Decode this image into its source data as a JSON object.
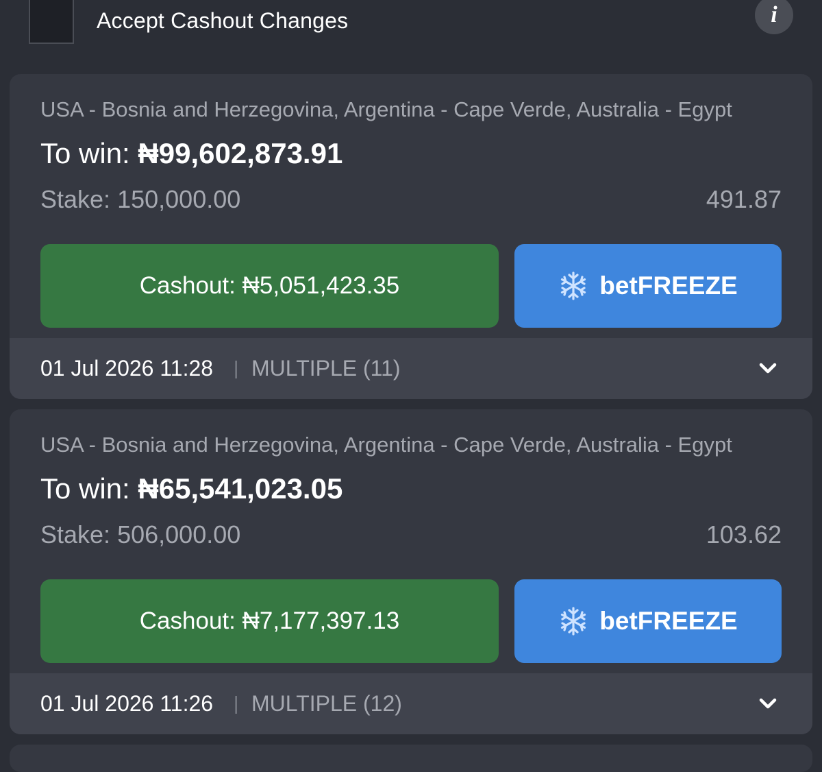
{
  "header": {
    "accept_label": "Accept Cashout Changes",
    "info_icon": "info-icon"
  },
  "bets": [
    {
      "events": "USA - Bosnia and Herzegovina, Argentina - Cape Verde, Australia - Egypt",
      "to_win_label": "To win:",
      "to_win_amount": "₦99,602,873.91",
      "stake_label": "Stake:",
      "stake_value": "150,000.00",
      "odds": "491.87",
      "cashout_label": "Cashout:",
      "cashout_amount": "₦5,051,423.35",
      "freeze_label": "betFREEZE",
      "date": "01 Jul 2026 11:28",
      "separator": "|",
      "bet_type": "MULTIPLE (11)"
    },
    {
      "events": "USA - Bosnia and Herzegovina, Argentina - Cape Verde, Australia - Egypt",
      "to_win_label": "To win:",
      "to_win_amount": "₦65,541,023.05",
      "stake_label": "Stake:",
      "stake_value": "506,000.00",
      "odds": "103.62",
      "cashout_label": "Cashout:",
      "cashout_amount": "₦7,177,397.13",
      "freeze_label": "betFREEZE",
      "date": "01 Jul 2026 11:26",
      "separator": "|",
      "bet_type": "MULTIPLE (12)"
    }
  ],
  "colors": {
    "background": "#2b2e36",
    "card": "#353841",
    "card_footer": "#40434d",
    "cashout_green": "#367842",
    "freeze_blue": "#3f86dd",
    "muted_text": "#a6a9b1"
  }
}
